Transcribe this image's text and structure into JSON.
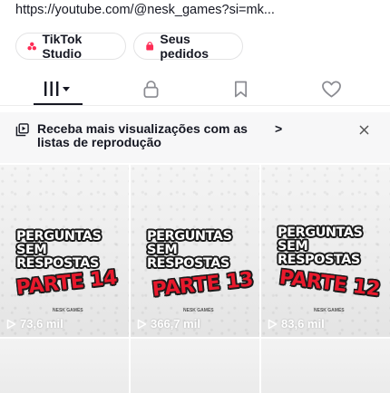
{
  "profile": {
    "bio_link": "https://youtube.com/@nesk_games?si=mk..."
  },
  "actions": {
    "tiktok_studio": "TikTok Studio",
    "orders": "Seus pedidos"
  },
  "tabs": [
    {
      "name": "videos-tab",
      "icon": "grid-lines-icon",
      "selected": true
    },
    {
      "name": "private-tab",
      "icon": "lock-icon"
    },
    {
      "name": "saved-tab",
      "icon": "bookmark-icon"
    },
    {
      "name": "liked-tab",
      "icon": "heart-icon"
    }
  ],
  "banner": {
    "text": "Receba mais visualizações com as listas de reprodução",
    "chevron": ">",
    "close_icon": "close-icon"
  },
  "videos": [
    {
      "title": "PERGUNTAS SEM RESPOSTAS",
      "part": "PARTE 14",
      "watermark": "NESK GAMES",
      "views": "73,6 mil"
    },
    {
      "title": "PERGUNTAS SEM RESPOSTAS",
      "part": "PARTE 13",
      "watermark": "NESK GAMES",
      "views": "366,7 mil"
    },
    {
      "title": "PERGUNTAS SEM RESPOSTAS",
      "part": "PARTE 12",
      "watermark": "NESK GAMES",
      "views": "83,6 mil"
    }
  ],
  "colors": {
    "accent_red": "#e8192c",
    "studio_icon": "#fe2c55",
    "text": "#161823",
    "banner_bg": "#f7f7f8"
  }
}
